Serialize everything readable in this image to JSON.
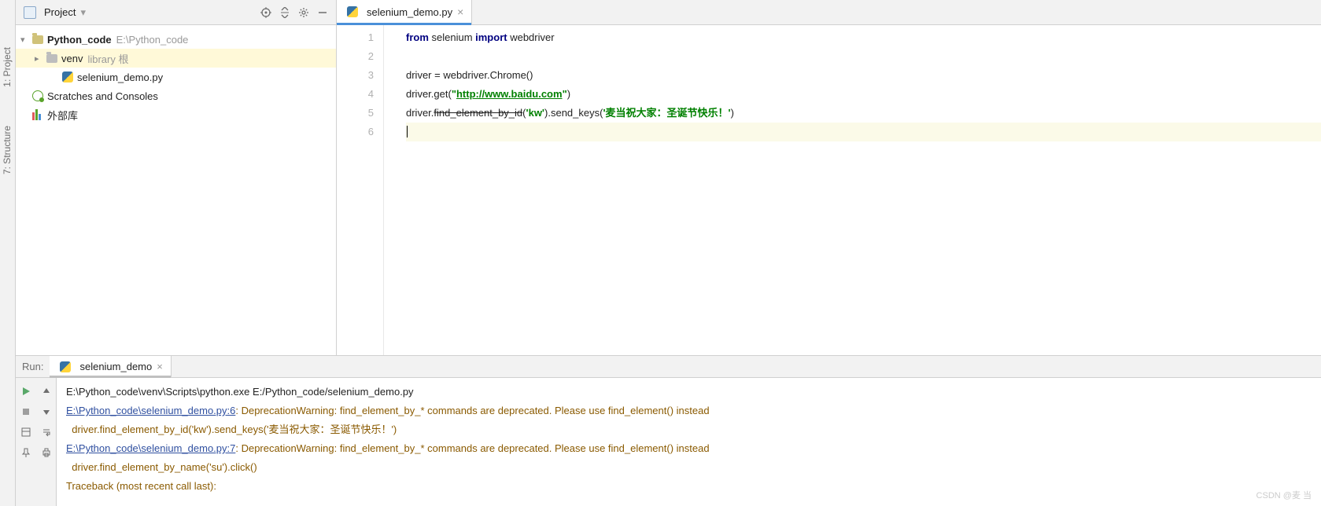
{
  "toolwindows": {
    "project": "1: Project",
    "structure": "7: Structure"
  },
  "projectPanel": {
    "title": "Project",
    "root": {
      "name": "Python_code",
      "path": "E:\\Python_code"
    },
    "venv": {
      "name": "venv",
      "hint": "library 根"
    },
    "file": "selenium_demo.py",
    "scratches": "Scratches and Consoles",
    "external": "外部库"
  },
  "editor": {
    "tab": "selenium_demo.py",
    "gutter": [
      "1",
      "2",
      "3",
      "4",
      "5",
      "6"
    ],
    "code": {
      "l1": {
        "kw1": "from",
        "p1": " selenium ",
        "kw2": "import",
        "p2": " webdriver"
      },
      "l3": "driver = webdriver.Chrome()",
      "l4": {
        "pre": "driver.get(",
        "q1": "\"",
        "url": "http://www.baidu.com",
        "q2": "\"",
        "post": ")"
      },
      "l5": {
        "pre": "driver.",
        "dep": "find_element_by_id",
        "mid": "(",
        "arg1": "'kw'",
        "mid2": ").send_keys(",
        "arg2": "'麦当祝大家：圣诞节快乐！'",
        "post": ")"
      }
    }
  },
  "run": {
    "label": "Run:",
    "tab": "selenium_demo",
    "lines": {
      "l1": "E:\\Python_code\\venv\\Scripts\\python.exe E:/Python_code/selenium_demo.py",
      "l2link": "E:\\Python_code\\selenium_demo.py:6",
      "l2warn": ": DeprecationWarning: find_element_by_* commands are deprecated. Please use find_element() instead",
      "l3": "  driver.find_element_by_id('kw').send_keys('麦当祝大家：圣诞节快乐！')",
      "l4link": "E:\\Python_code\\selenium_demo.py:7",
      "l4warn": ": DeprecationWarning: find_element_by_* commands are deprecated. Please use find_element() instead",
      "l5": "  driver.find_element_by_name('su').click()",
      "l6": "Traceback (most recent call last):"
    }
  },
  "watermark": "CSDN @麦 当"
}
